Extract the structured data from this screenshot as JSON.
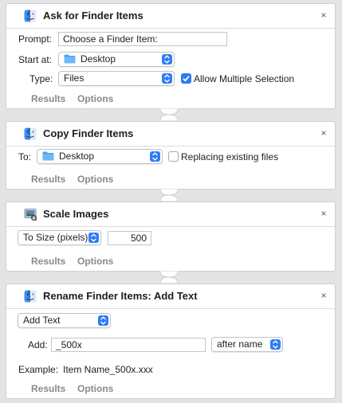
{
  "actions": [
    {
      "title": "Ask for Finder Items",
      "icon": "finder-icon",
      "prompt_label": "Prompt:",
      "prompt_value": "Choose a Finder Item:",
      "start_label": "Start at:",
      "start_value": "Desktop",
      "type_label": "Type:",
      "type_value": "Files",
      "allow_multiple_label": "Allow Multiple Selection",
      "allow_multiple_checked": true,
      "results_label": "Results",
      "options_label": "Options"
    },
    {
      "title": "Copy Finder Items",
      "icon": "finder-icon",
      "to_label": "To:",
      "to_value": "Desktop",
      "replacing_label": "Replacing existing files",
      "replacing_checked": false,
      "results_label": "Results",
      "options_label": "Options"
    },
    {
      "title": "Scale Images",
      "icon": "preview-icon",
      "mode_value": "To Size (pixels)",
      "size_value": "500",
      "results_label": "Results",
      "options_label": "Options"
    },
    {
      "title": "Rename Finder Items: Add Text",
      "icon": "finder-icon",
      "mode_value": "Add Text",
      "add_label": "Add:",
      "add_value": "_500x",
      "position_value": "after name",
      "example_label": "Example:",
      "example_value": "Item Name_500x.xxx",
      "results_label": "Results",
      "options_label": "Options"
    }
  ],
  "close_glyph": "×",
  "colors": {
    "accent": "#2f7cf6",
    "background": "#e4e4e7",
    "footer_text": "#8a8a8e"
  }
}
